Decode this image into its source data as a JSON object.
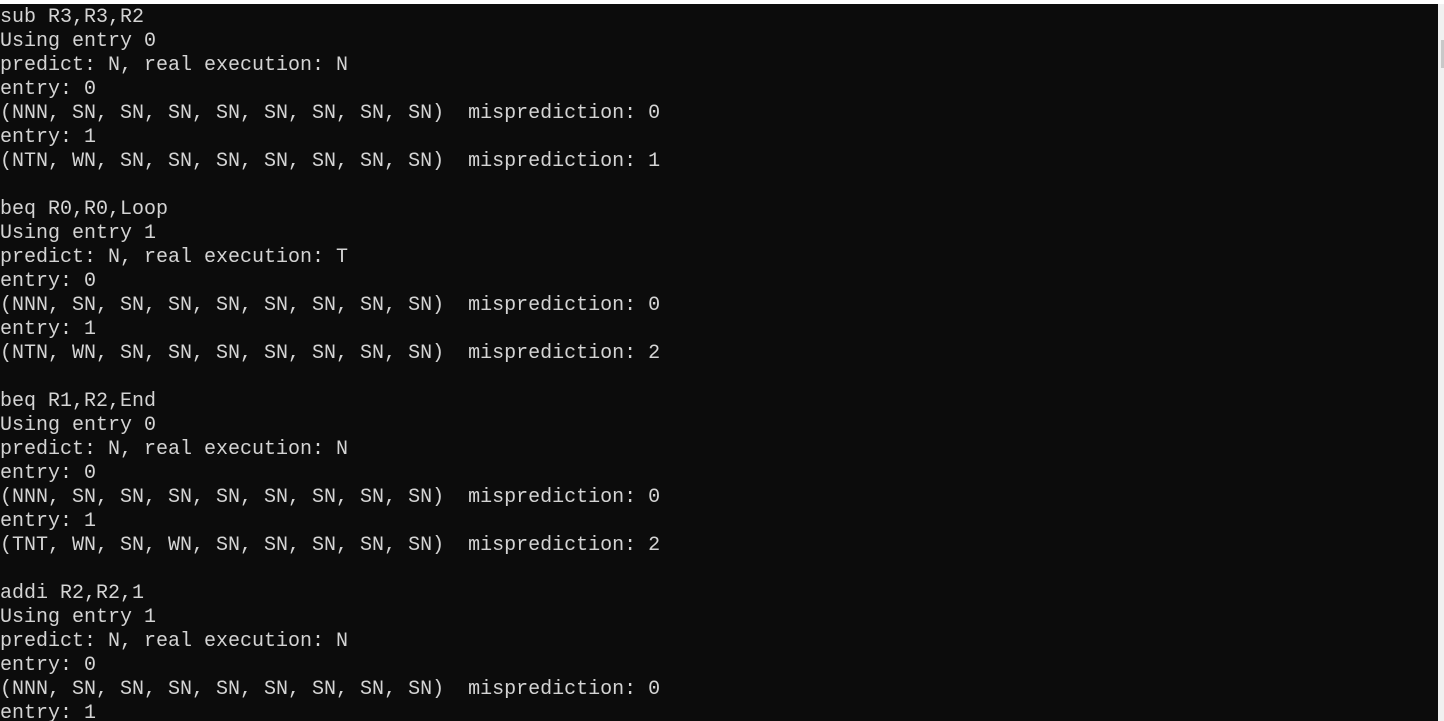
{
  "terminal": {
    "lines": [
      "sub R3,R3,R2",
      "Using entry 0",
      "predict: N, real execution: N",
      "entry: 0",
      "(NNN, SN, SN, SN, SN, SN, SN, SN, SN)  misprediction: 0",
      "entry: 1",
      "(NTN, WN, SN, SN, SN, SN, SN, SN, SN)  misprediction: 1",
      "",
      "beq R0,R0,Loop",
      "Using entry 1",
      "predict: N, real execution: T",
      "entry: 0",
      "(NNN, SN, SN, SN, SN, SN, SN, SN, SN)  misprediction: 0",
      "entry: 1",
      "(NTN, WN, SN, SN, SN, SN, SN, SN, SN)  misprediction: 2",
      "",
      "beq R1,R2,End",
      "Using entry 0",
      "predict: N, real execution: N",
      "entry: 0",
      "(NNN, SN, SN, SN, SN, SN, SN, SN, SN)  misprediction: 0",
      "entry: 1",
      "(TNT, WN, SN, WN, SN, SN, SN, SN, SN)  misprediction: 2",
      "",
      "addi R2,R2,1",
      "Using entry 1",
      "predict: N, real execution: N",
      "entry: 0",
      "(NNN, SN, SN, SN, SN, SN, SN, SN, SN)  misprediction: 0",
      "entry: 1"
    ]
  }
}
